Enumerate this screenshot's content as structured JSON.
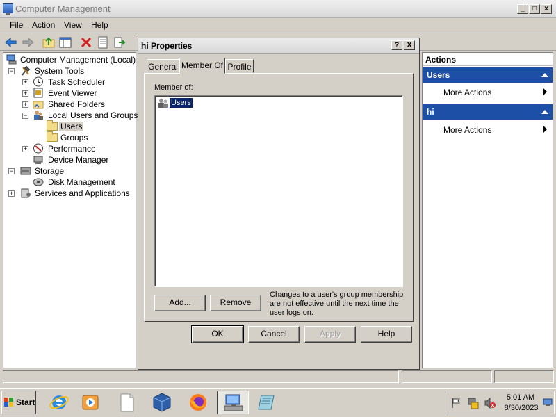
{
  "window": {
    "title": "Computer Management"
  },
  "menu": [
    "File",
    "Action",
    "View",
    "Help"
  ],
  "tree": {
    "root": "Computer Management (Local)",
    "items": [
      {
        "label": "System Tools"
      },
      {
        "label": "Task Scheduler"
      },
      {
        "label": "Event Viewer"
      },
      {
        "label": "Shared Folders"
      },
      {
        "label": "Local Users and Groups"
      },
      {
        "label": "Users"
      },
      {
        "label": "Groups"
      },
      {
        "label": "Performance"
      },
      {
        "label": "Device Manager"
      },
      {
        "label": "Storage"
      },
      {
        "label": "Disk Management"
      },
      {
        "label": "Services and Applications"
      }
    ]
  },
  "actions": {
    "header": "Actions",
    "sections": [
      {
        "title": "Users",
        "item": "More Actions"
      },
      {
        "title": "hi",
        "item": "More Actions"
      }
    ]
  },
  "dialog": {
    "title": "hi Properties",
    "help_button": "?",
    "close_button": "X",
    "tabs": [
      "General",
      "Member Of",
      "Profile"
    ],
    "active_tab": "Member Of",
    "member_of_label": "Member of:",
    "members": [
      "Users"
    ],
    "add_label": "Add...",
    "remove_label": "Remove",
    "note": "Changes to a user's group membership are not effective until the next time the user logs on.",
    "ok_label": "OK",
    "cancel_label": "Cancel",
    "apply_label": "Apply",
    "help_label": "Help"
  },
  "taskbar": {
    "start_label": "Start",
    "clock_time": "5:01 AM",
    "clock_date": "8/30/2023"
  },
  "icons": {
    "start": "windows-flag-icon",
    "browser": "internet-explorer-icon",
    "media": "media-player-icon",
    "file": "blank-document-icon",
    "vbox": "virtualbox-icon",
    "firefox": "firefox-icon",
    "computer_mgmt": "computer-management-icon",
    "notepad": "notepad-icon"
  }
}
